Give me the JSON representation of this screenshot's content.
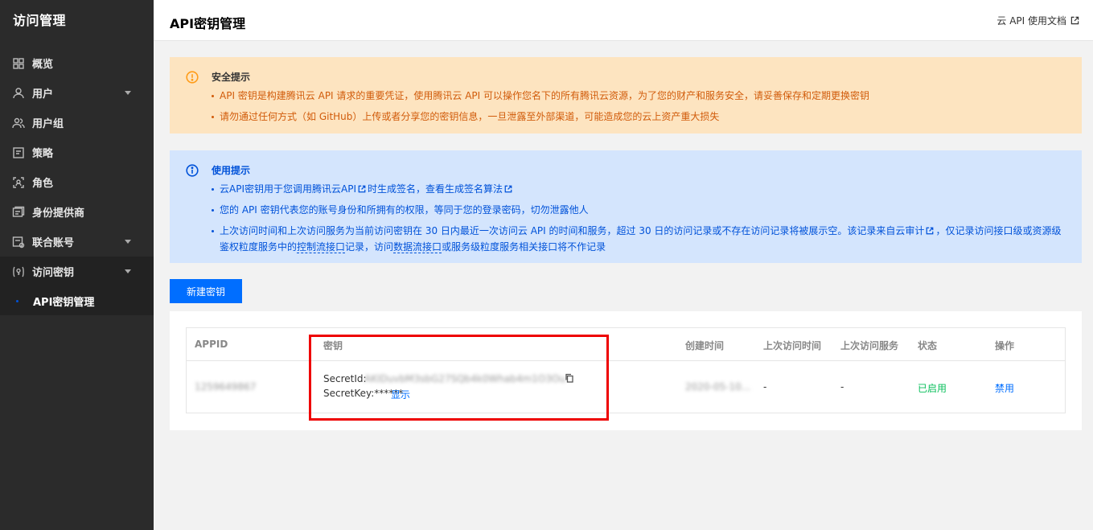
{
  "sidebar": {
    "title": "访问管理",
    "items": [
      {
        "label": "概览",
        "icon": "grid-icon"
      },
      {
        "label": "用户",
        "icon": "user-icon",
        "caret": true
      },
      {
        "label": "用户组",
        "icon": "user-group-icon"
      },
      {
        "label": "策略",
        "icon": "policy-icon"
      },
      {
        "label": "角色",
        "icon": "role-icon"
      },
      {
        "label": "身份提供商",
        "icon": "identity-provider-icon"
      },
      {
        "label": "联合账号",
        "icon": "federated-account-icon",
        "caret": true
      },
      {
        "label": "访问密钥",
        "icon": "access-key-icon",
        "caret": true
      }
    ],
    "sub_item": "API密钥管理"
  },
  "header": {
    "title": "API密钥管理",
    "doc_link": "云 API 使用文档"
  },
  "warning": {
    "title": "安全提示",
    "items": [
      "API 密钥是构建腾讯云 API 请求的重要凭证，使用腾讯云 API 可以操作您名下的所有腾讯云资源，为了您的财产和服务安全，请妥善保存和定期更换密钥",
      "请勿通过任何方式（如 GitHub）上传或者分享您的密钥信息，一旦泄露至外部渠道，可能造成您的云上资产重大损失"
    ]
  },
  "info": {
    "title": "使用提示",
    "item1": {
      "a": "云API密钥用于您调用",
      "link1": "腾讯云API",
      "b": "时生成签名，查看",
      "link2": "生成签名算法"
    },
    "item2": "您的 API 密钥代表您的账号身份和所拥有的权限，等同于您的登录密码，切勿泄露他人",
    "item3": {
      "a": "上次访问时间和上次访问服务为当前访问密钥在 30 日内最近一次访问云 API 的时间和服务，超过 30 日的访问记录或不存在访问记录将被展示空。该记录来自",
      "link": "云审计",
      "b": "，仅记录访问接口级或资源级鉴权粒度服务中的",
      "dashed1": "控制流接口",
      "c": "记录，访问",
      "dashed2": "数据流接口",
      "d": "或服务级粒度服务相关接口将不作记录"
    }
  },
  "new_key_button": "新建密钥",
  "table": {
    "headers": [
      "APPID",
      "密钥",
      "创建时间",
      "上次访问时间",
      "上次访问服务",
      "状态",
      "操作"
    ],
    "row": {
      "appid": "1259649867",
      "secret_id_label": "SecretId:",
      "secret_id": "AKIDuvbM3sbG27SQb4k0Whab4m1O3Ou4Fmk",
      "secret_key_label": "SecretKey:******",
      "show_link": "显示",
      "created": "2020-05-10...",
      "last_access_time": "-",
      "last_access_service": "-",
      "status": "已启用",
      "action": "禁用"
    }
  },
  "colors": {
    "primary": "#006eff",
    "warning_bg": "#fde4c0",
    "info_bg": "#d4e5fd",
    "enabled": "#0abf5b",
    "highlight": "#e00000"
  }
}
